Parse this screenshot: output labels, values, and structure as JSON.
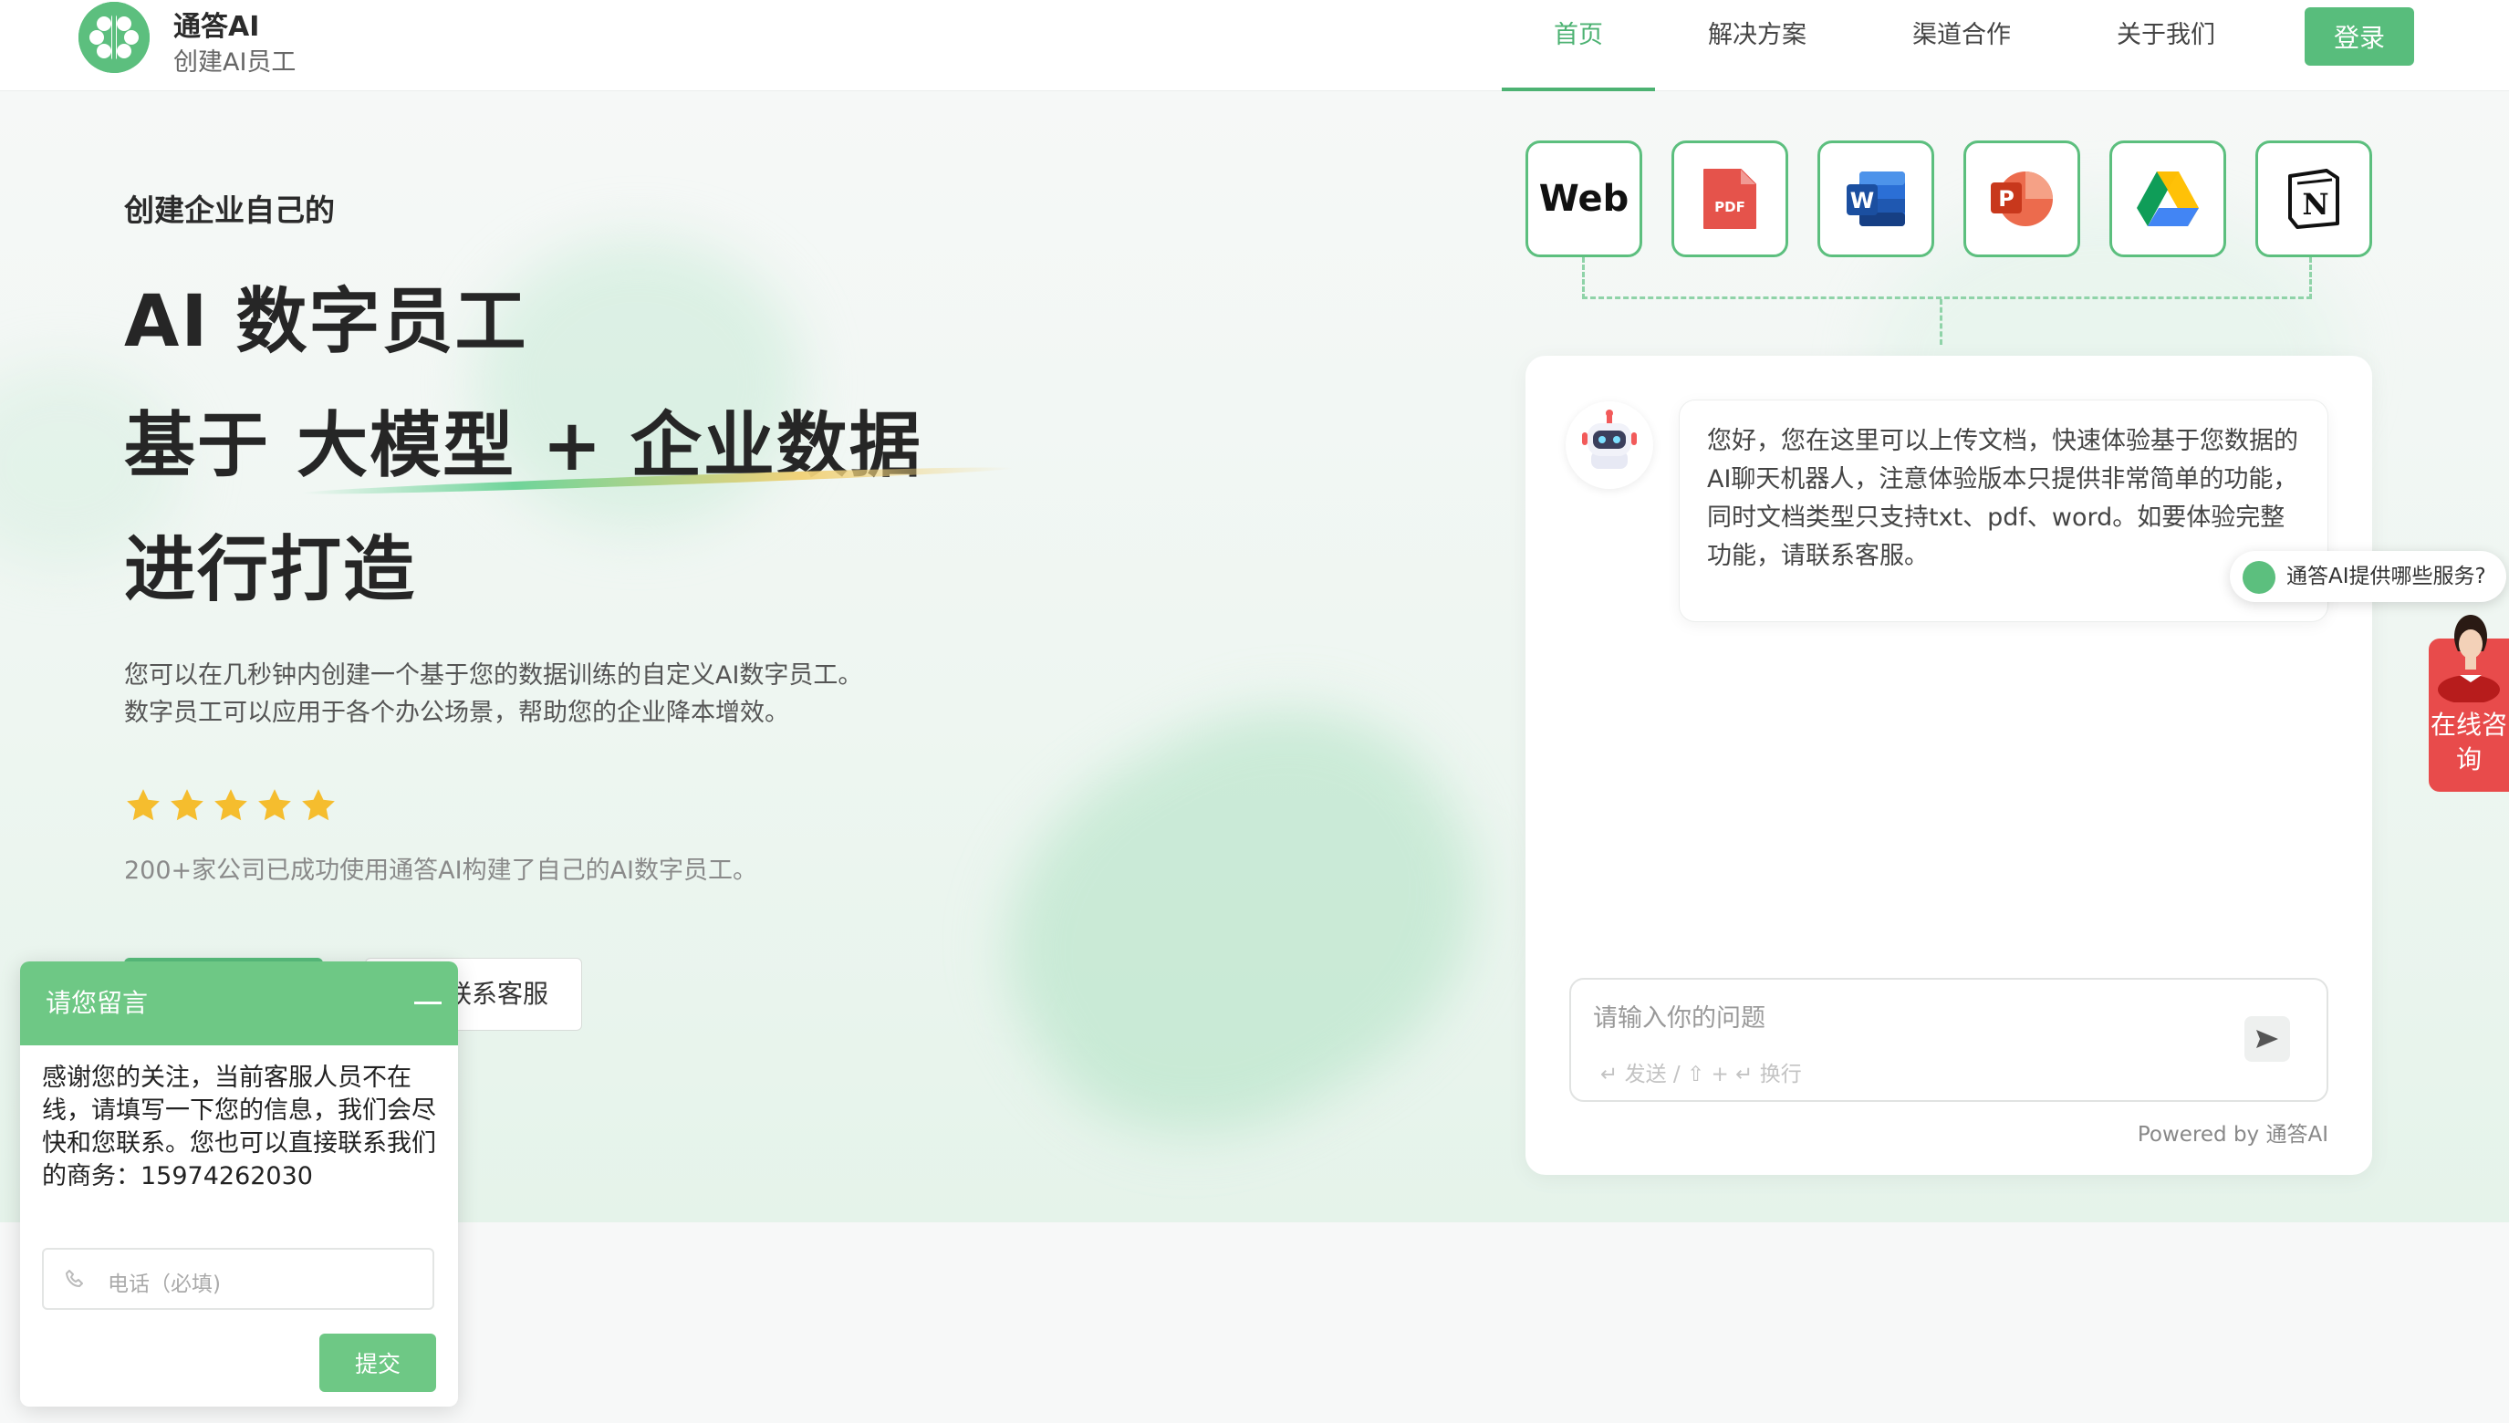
{
  "brand": {
    "name": "通答AI",
    "subtitle": "创建AI员工"
  },
  "nav": {
    "items": [
      {
        "label": "首页",
        "active": true
      },
      {
        "label": "解决方案",
        "active": false
      },
      {
        "label": "渠道合作",
        "active": false
      },
      {
        "label": "关于我们",
        "active": false
      }
    ],
    "login_label": "登录"
  },
  "hero": {
    "kicker": "创建企业自己的",
    "headline_1": "AI 数字员工",
    "headline_2": "基于 大模型 + 企业数据",
    "headline_3": "进行打造",
    "description": "您可以在几秒钟内创建一个基于您的数据训练的自定义AI数字员工。数字员工可以应用于各个办公场景，帮助您的企业降本增效。",
    "rating_stars": 5,
    "social_proof": "200+家公司已成功使用通答AI构建了自己的AI数字员工。",
    "contact_button": "联系客服"
  },
  "sources": [
    {
      "icon": "web-icon",
      "label": "Web"
    },
    {
      "icon": "pdf-icon",
      "label": "PDF"
    },
    {
      "icon": "word-icon",
      "label": "W"
    },
    {
      "icon": "powerpoint-icon",
      "label": "P"
    },
    {
      "icon": "google-drive-icon",
      "label": ""
    },
    {
      "icon": "notion-icon",
      "label": "N"
    }
  ],
  "chat": {
    "bot_message": "您好，您在这里可以上传文档，快速体验基于您数据的AI聊天机器人，注意体验版本只提供非常简单的功能，同时文档类型只支持txt、pdf、word。如要体验完整功能，请联系客服。",
    "input_placeholder": "请输入你的问题",
    "hint": "↵ 发送 / ⇧ + ↵ 换行",
    "powered_by": "Powered by 通答AI"
  },
  "floating": {
    "faq_chip": "通答AI提供哪些服务?",
    "online_consult": "在线咨询"
  },
  "message_panel": {
    "title": "请您留言",
    "body": "感谢您的关注，当前客服人员不在线，请填写一下您的信息，我们会尽快和您联系。您也可以直接联系我们的商务：15974262030",
    "phone_placeholder": "电话（必填)",
    "submit_label": "提交"
  },
  "colors": {
    "brand_green": "#58bd7c",
    "accent_red": "#e84b4b"
  }
}
